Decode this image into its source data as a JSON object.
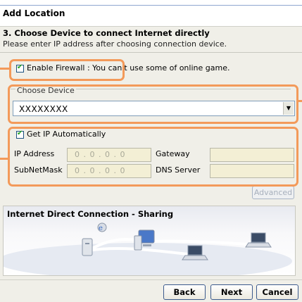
{
  "window": {
    "title": "Add Location"
  },
  "step": {
    "title": "3. Choose Device to connect Internet directly",
    "description": "Please enter IP address after choosing connection device."
  },
  "firewall": {
    "checked": true,
    "label": "Enable Firewall : You can't use some of online game."
  },
  "device": {
    "section_label": "Choose Device",
    "selected_value": "XXXXXXXX"
  },
  "ip_settings": {
    "auto_checked": true,
    "auto_label": "Get IP Automatically",
    "ip_address_label": "IP Address",
    "ip_address_value": "0 . 0 . 0 . 0",
    "subnet_label": "SubNetMask",
    "subnet_value": "0 . 0 . 0 . 0",
    "gateway_label": "Gateway",
    "gateway_value": "",
    "dns_label": "DNS Server",
    "dns_value": ""
  },
  "advanced_button": "Advanced",
  "diagram": {
    "title": "Internet Direct Connection - Sharing",
    "icons": [
      "globe-icon",
      "pc-tower-icon",
      "desktop-pc-icon",
      "laptop-icon",
      "laptop-icon"
    ]
  },
  "buttons": {
    "back": "Back",
    "next": "Next",
    "cancel": "Cancel"
  },
  "colors": {
    "callout": "#f39a5a",
    "disabled_field": "#f3efd5",
    "dialog_bg": "#f0efe8"
  }
}
